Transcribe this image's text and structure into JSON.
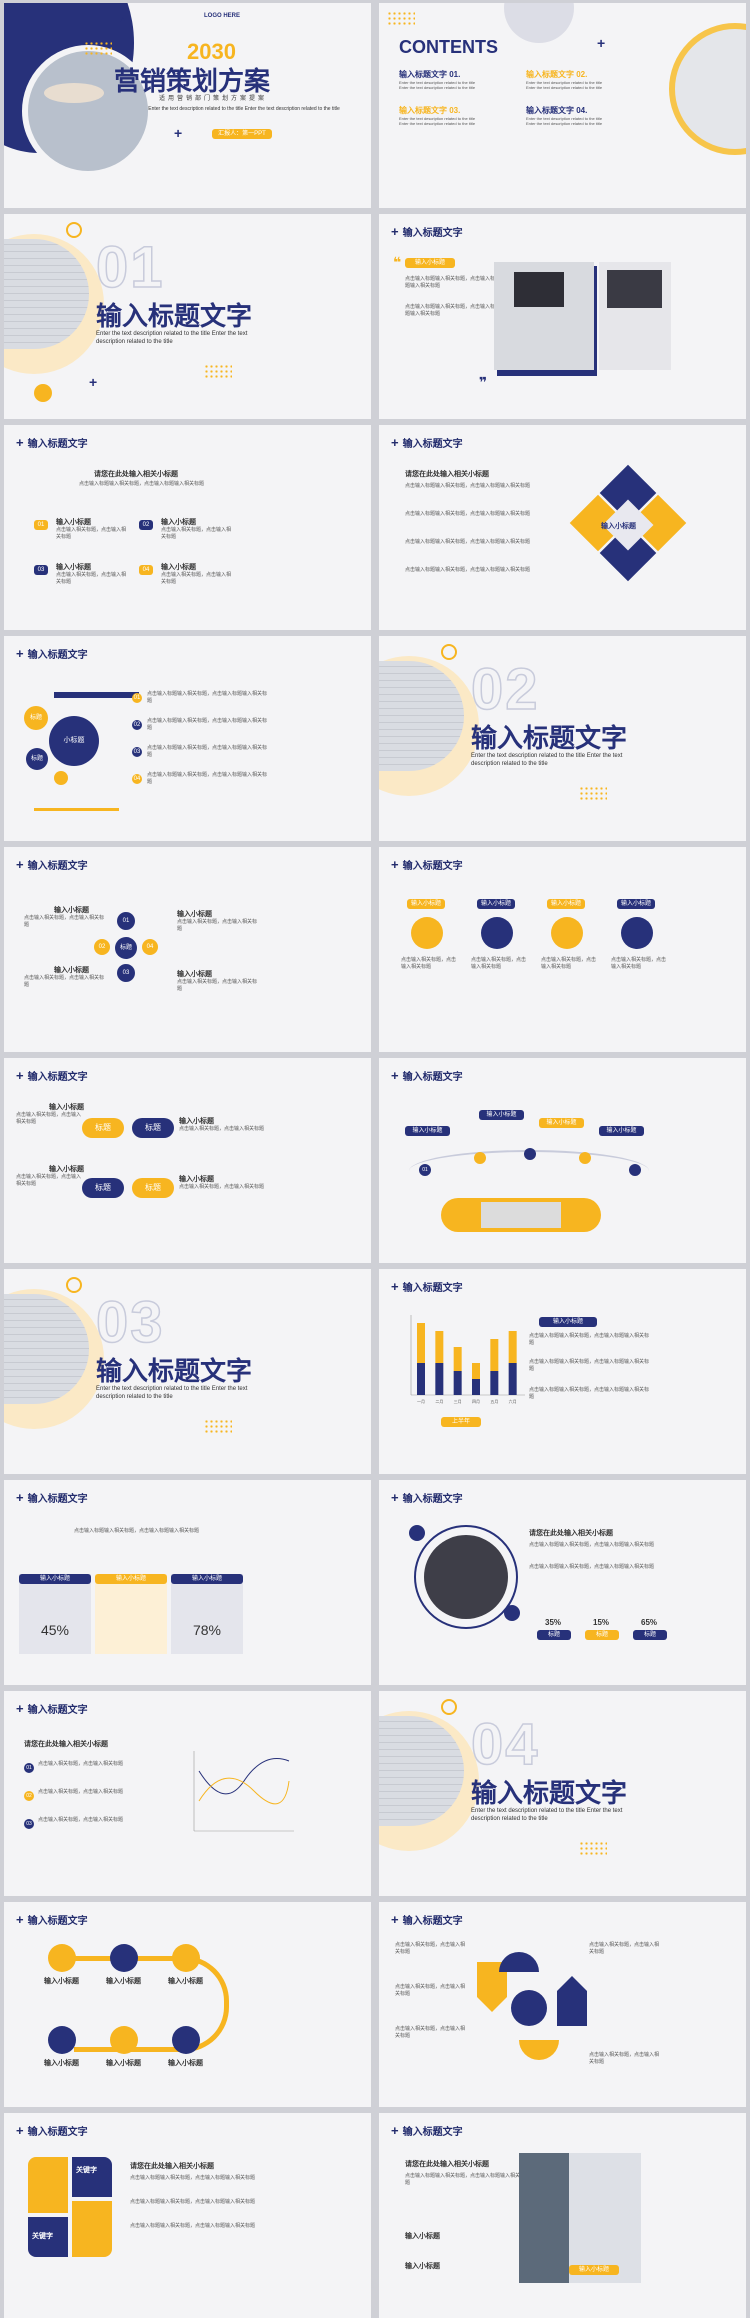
{
  "cover": {
    "logo": "LOGO HERE",
    "year": "2030",
    "title": "营销策划方案",
    "subtitle": "适用营销部门策划方案提案",
    "desc": "Enter the text description related to the title Enter the text description related to the title",
    "presenter": "汇报人：第一PPT"
  },
  "contents": {
    "heading": "CONTENTS",
    "items": [
      {
        "label": "输入标题文字 01.",
        "desc": "Enter the text description related to the title Enter the text description related to the title"
      },
      {
        "label": "输入标题文字 02.",
        "desc": "Enter the text description related to the title Enter the text description related to the title"
      },
      {
        "label": "输入标题文字 03.",
        "desc": "Enter the text description related to the title Enter the text description related to the title"
      },
      {
        "label": "输入标题文字 04.",
        "desc": "Enter the text description related to the title Enter the text description related to the title"
      }
    ]
  },
  "common": {
    "slide_title": "输入标题文字",
    "sub": "输入小标题",
    "sub_long": "请您在此处输入相关小标题",
    "filler": "点击输入标题输入相关标题，点击输入标题输入相关标题",
    "filler_short": "点击输入相关标题，点击输入相关标题",
    "section_en": "Enter the text description related to the title Enter the text description related to the title",
    "tag": "标题",
    "center": "小标题",
    "keyword": "关键字",
    "bottom_tag": "上半年"
  },
  "sections": [
    "01",
    "02",
    "03",
    "04"
  ],
  "percents_a": [
    "45%",
    "78%"
  ],
  "percents_b": [
    "35%",
    "15%",
    "65%"
  ],
  "nums": [
    "01",
    "02",
    "03",
    "04"
  ],
  "chart_data": {
    "type": "bar",
    "categories": [
      "一月",
      "二月",
      "三月",
      "四月",
      "五月",
      "六月"
    ],
    "series": [
      {
        "name": "",
        "values": [
          9,
          8,
          6,
          4,
          7,
          8
        ]
      },
      {
        "name": "",
        "values": [
          4,
          4,
          3,
          2,
          3,
          4
        ]
      }
    ],
    "ylim": [
      0,
      10
    ]
  },
  "colors": {
    "navy": "#27317a",
    "yellow": "#f7b520",
    "bg": "#f4f4f6"
  }
}
